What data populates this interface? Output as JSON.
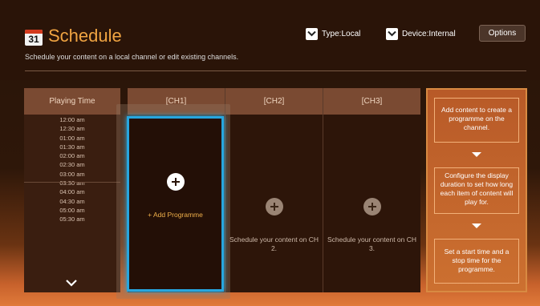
{
  "header": {
    "calendar_day": "31",
    "title": "Schedule",
    "subtitle": "Schedule your content on a local channel or edit existing channels.",
    "type_dropdown": "Type:Local",
    "device_dropdown": "Device:Internal",
    "options_label": "Options"
  },
  "playing_time": {
    "header": "Playing Time",
    "times": [
      "12:00 am",
      "12:30 am",
      "01:00 am",
      "01:30 am",
      "02:00 am",
      "02:30 am",
      "03:00 am",
      "03:30 am",
      "04:00 am",
      "04:30 am",
      "05:00 am",
      "05:30 am"
    ]
  },
  "channels": [
    {
      "header": "[CH1]",
      "label": "+ Add Programme"
    },
    {
      "header": "[CH2]",
      "label": "Schedule your content on CH 2."
    },
    {
      "header": "[CH3]",
      "label": "Schedule your content on CH 3."
    }
  ],
  "help": {
    "step1": "Add content to create a programme on the channel.",
    "step2": "Configure the display duration to set how long each item of content will play for.",
    "step3": "Set a start time and a stop time for the programme."
  },
  "colors": {
    "accent": "#f0a442",
    "focus": "#27a6df",
    "help_panel": "#c0642c"
  }
}
